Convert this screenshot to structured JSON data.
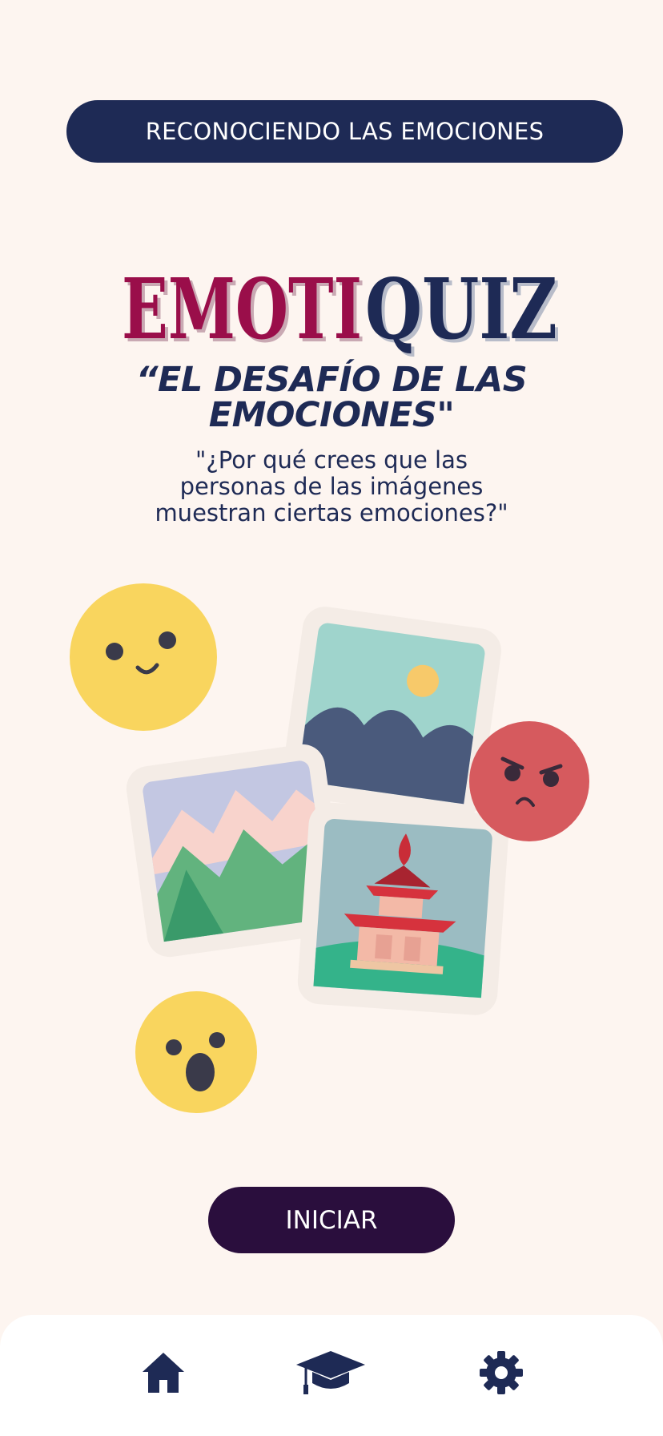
{
  "header": {
    "title": "RECONOCIENDO LAS EMOCIONES"
  },
  "logo": {
    "part1": "EMOTI",
    "part2": "QUIZ",
    "color1": "#9a0e4a",
    "color2": "#1e2a55"
  },
  "subtitle": {
    "line1": "“EL DESAFÍO DE LAS",
    "line2": "EMOCIONES\""
  },
  "question": {
    "line1": "\"¿Por qué crees que las",
    "line2": "personas de las imágenes",
    "line3": "muestran ciertas emociones?\""
  },
  "actions": {
    "start_label": "INICIAR"
  },
  "nav": {
    "items": [
      {
        "icon": "home-icon"
      },
      {
        "icon": "graduation-cap-icon"
      },
      {
        "icon": "gear-icon"
      }
    ]
  },
  "colors": {
    "background": "#fdf5f0",
    "navy": "#1e2a55",
    "button": "#2a0e3d",
    "happy_face": "#f9d55e",
    "angry_face": "#d65a5e"
  }
}
